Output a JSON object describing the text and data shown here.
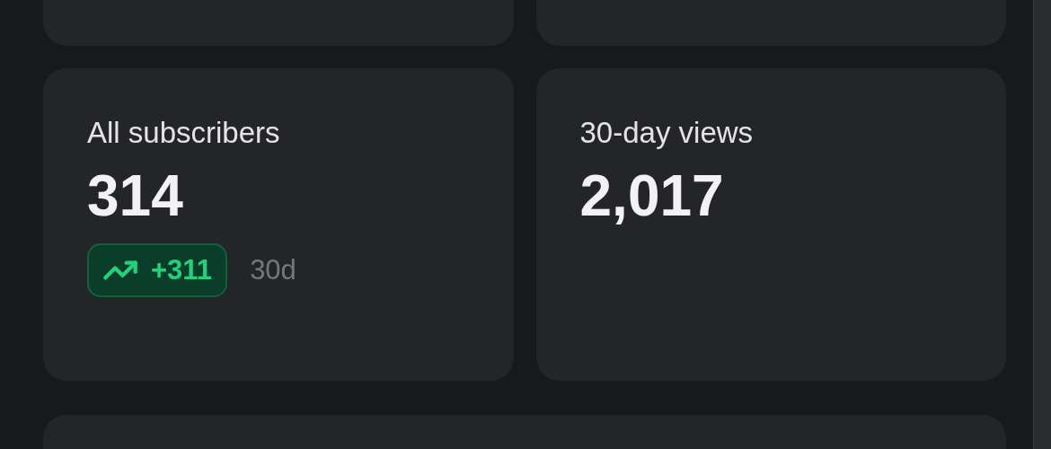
{
  "stats": [
    {
      "label": "All subscribers",
      "value": "314",
      "change": {
        "text": "+311",
        "period": "30d"
      }
    },
    {
      "label": "30-day views",
      "value": "2,017"
    }
  ]
}
